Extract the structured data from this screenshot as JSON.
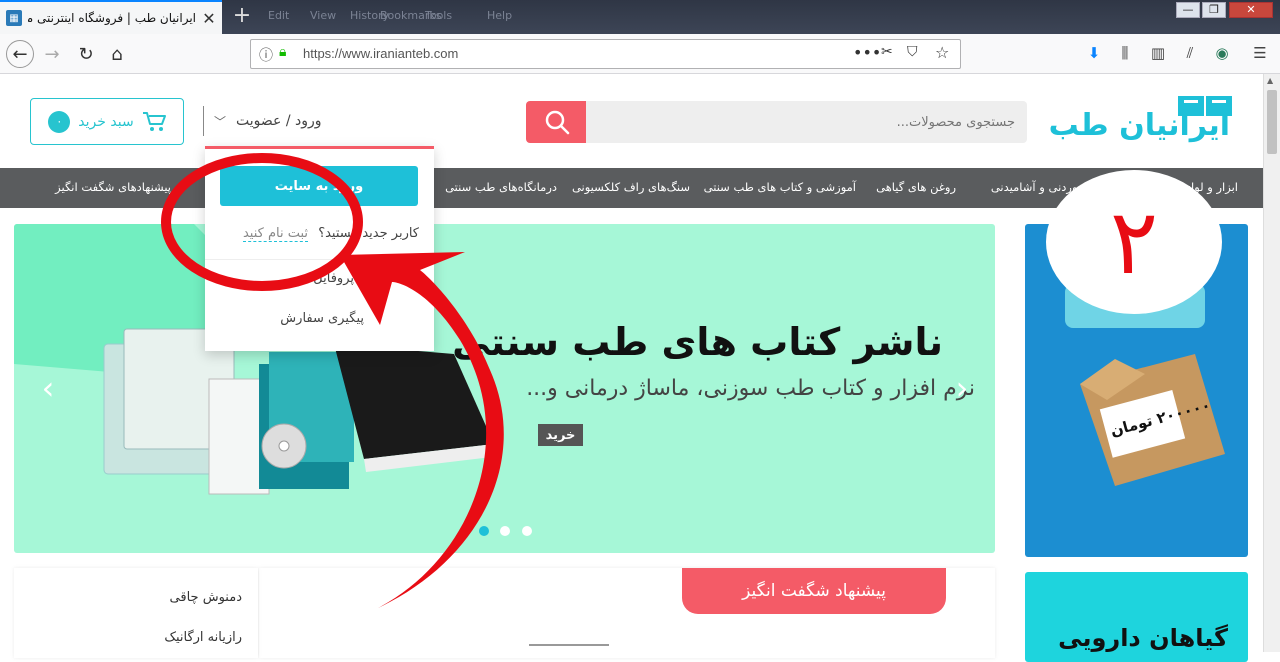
{
  "browser": {
    "tab_title": "ایرانیان طب | فروشگاه اینترنتی محصولات",
    "new_tab": "+",
    "menu_faded": [
      "Edit",
      "View",
      "History",
      "Bookmarks",
      "Tools",
      "Help"
    ],
    "url": "https://www.iranianteb.com"
  },
  "header": {
    "cart_label": "سبد خرید",
    "cart_count": "۰",
    "login_label": "ورود / عضویت",
    "search_placeholder": "جستجوی محصولات...",
    "logo_text": "ایرانیان طب"
  },
  "menu": {
    "items": [
      "ابزار و لوازم",
      "خوردنی و آشامیدنی",
      "روغن های گیاهی",
      "آموزشی و کتاب های طب سنتی",
      "سنگ‌های راف کلکسیونی",
      "درمانگاه‌های طب سنتی",
      "پیشنهادهای شگفت انگیز"
    ]
  },
  "dropdown": {
    "login_button": "ورود به سایت",
    "new_user_question": "کاربر جدید هستید؟",
    "register_link": "ثبت نام کنید",
    "profile": "پروفایل",
    "order_tracking": "پیگیری سفارش"
  },
  "slider": {
    "headline": "ناشر کتاب های طب سنتی",
    "subline": "نرم افزار و کتاب طب سوزنی، ماساژ درمانی و...",
    "buy_button": "خرید",
    "slide_count": 3,
    "active_slide": 1
  },
  "ads": {
    "ad1_text": "۲۰۰۰۰۰ تومان",
    "ad2_text": "گیاهان دارویی"
  },
  "offer": {
    "badge": "پیشنهاد شگفت انگیز"
  },
  "categories": [
    "دمنوش چاقی",
    "رازیانه ارگانیک"
  ],
  "annotation": {
    "step_number": "۲",
    "color": "#e80c14"
  }
}
